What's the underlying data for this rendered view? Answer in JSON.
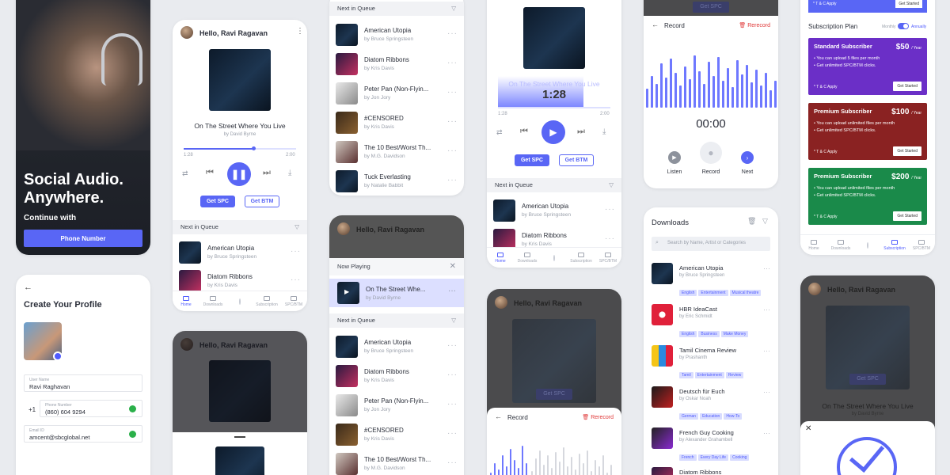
{
  "colors": {
    "accent": "#4f5bff",
    "bg": "#e9ebef",
    "red": "#e03a3a",
    "plan_standard": "#6b2fc7",
    "plan_premium": "#8a2222",
    "plan_green": "#1a8a4a"
  },
  "hero": {
    "headline": "Social Audio. Anywhere.",
    "subline": "Continue with",
    "phone_button": "Phone Number"
  },
  "profile": {
    "title": "Create Your Profile",
    "name_label": "User Name",
    "name_value": "Ravi Raghavan",
    "phone_label": "Phone Number",
    "country_code": "+1",
    "phone_value": "(860) 604 9294",
    "email_label": "Email ID",
    "email_value": "amcent@sbcglobal.net"
  },
  "player": {
    "greeting": "Hello, Ravi Ragavan",
    "song_title": "On The Street Where You Live",
    "artist": "by David Byrne",
    "time_start": "1:28",
    "time_end": "2:00",
    "get_spc": "Get SPC",
    "get_btm": "Get BTM",
    "scrub_time": "1:28",
    "progress": 0.62
  },
  "queue": {
    "header": "Next in Queue",
    "now_playing_header": "Now Playing",
    "now_playing_title": "On The Street Whe...",
    "now_playing_artist": "by David Byrne",
    "items": [
      {
        "title": "American Utopia",
        "artist": "by Bruce Springsteen"
      },
      {
        "title": "Diatom Ribbons",
        "artist": "by Kris Davis"
      },
      {
        "title": "Peter Pan (Non-Flyin...",
        "artist": "by Jon Jory"
      },
      {
        "title": "#CENSORED",
        "artist": "by Kris Davis"
      },
      {
        "title": "The 10 Best/Worst Th...",
        "artist": "by M.G. Davidson"
      },
      {
        "title": "Tuck Everlasting",
        "artist": "by Natalie Babbit"
      }
    ]
  },
  "tabs": {
    "home": "Home",
    "downloads": "Downloads",
    "subscription": "Subscription",
    "spc_btm": "SPC/BTM"
  },
  "record": {
    "title": "Record",
    "rerecord": "Rerecord",
    "timer": "00:00",
    "listen": "Listen",
    "record": "Record",
    "next": "Next"
  },
  "downloads": {
    "title": "Downloads",
    "search_placeholder": "Search by Name, Artist or Categories",
    "items": [
      {
        "title": "American Utopia",
        "artist": "by Bruce Springsteen",
        "tags": [
          "English",
          "Entertainment",
          "Musical theatre"
        ]
      },
      {
        "title": "HBR IdeaCast",
        "artist": "by Eric Schmidt",
        "tags": [
          "English",
          "Business",
          "Make Money"
        ]
      },
      {
        "title": "Tamil Cinema Review",
        "artist": "by Prashanth",
        "tags": [
          "Tamil",
          "Entertainment",
          "Review"
        ]
      },
      {
        "title": "Deutsch für Euch",
        "artist": "by Oskar Noah",
        "tags": [
          "German",
          "Education",
          "How-To"
        ]
      },
      {
        "title": "French Guy Cooking",
        "artist": "by Alexander Grahambell",
        "tags": [
          "French",
          "Every Day Life",
          "Cooking"
        ]
      },
      {
        "title": "Diatom Ribbons",
        "artist": "",
        "tags": []
      }
    ]
  },
  "subscription": {
    "top_tc": "* T & C Apply",
    "top_cta": "Get Started",
    "title": "Subscription Plan",
    "monthly": "Monthly",
    "annually": "Annually",
    "plans": [
      {
        "name": "Standard Subscriber",
        "price": "$50",
        "per": "/ Year",
        "f1": "You can upload 5 files per month",
        "f2": "Get unlimited SPC/BTM clicks.",
        "tc": "* T & C Apply",
        "cta": "Get Started"
      },
      {
        "name": "Premium Subscriber",
        "price": "$100",
        "per": "/ Year",
        "f1": "You can upload unlimited files per month",
        "f2": "Get unlimited SPC/BTM clicks.",
        "tc": "* T & C Apply",
        "cta": "Get Started"
      },
      {
        "name": "Premium Subscriber",
        "price": "$200",
        "per": "/ Year",
        "f1": "You can upload unlimited files per month",
        "f2": "Get unlimited SPC/BTM clicks.",
        "tc": "* T & C Apply",
        "cta": "Get Started"
      }
    ]
  }
}
